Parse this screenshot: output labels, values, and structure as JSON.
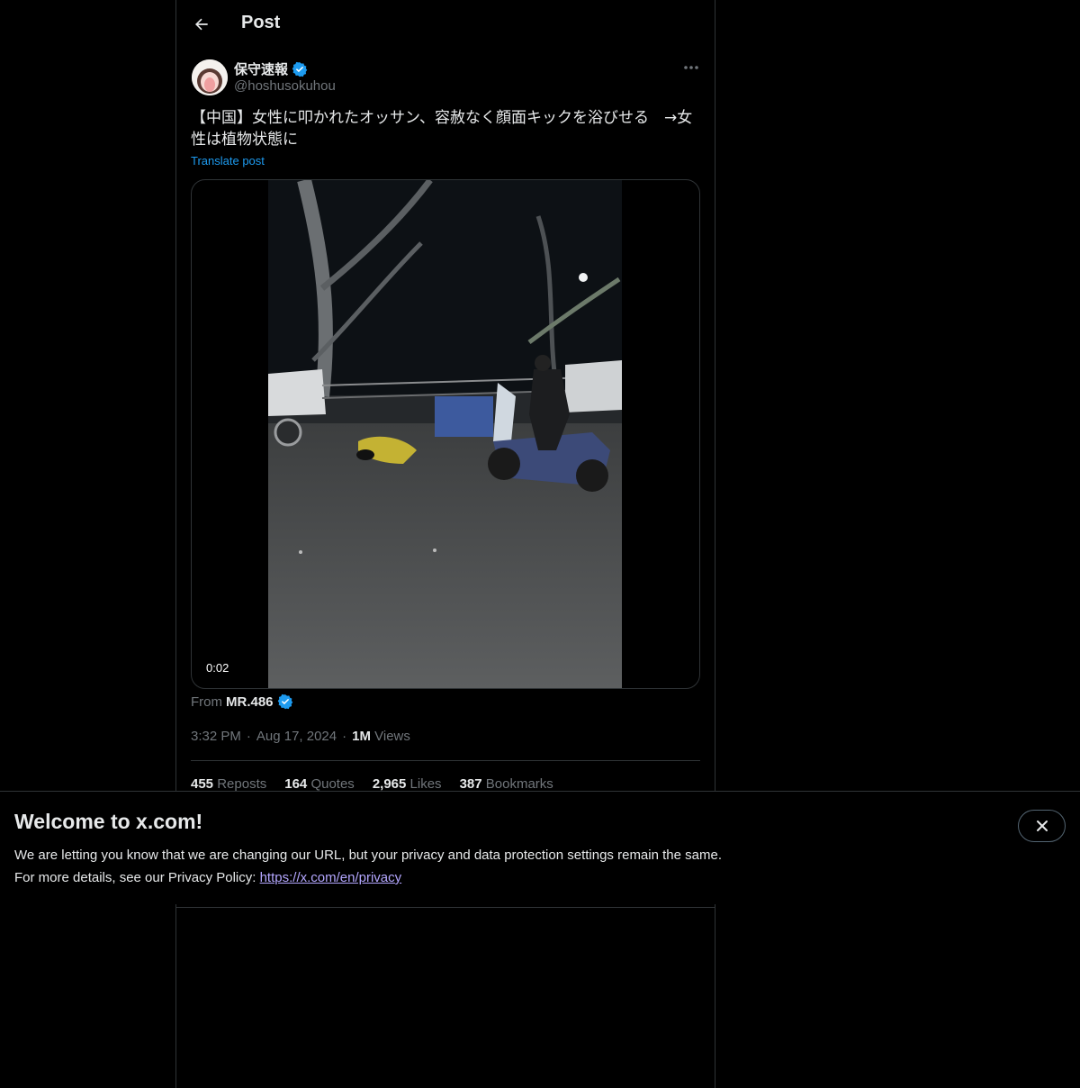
{
  "header": {
    "title": "Post",
    "back_icon": "arrow-left-icon"
  },
  "post": {
    "author": {
      "display_name": "保守速報",
      "handle": "@hoshusokuhou",
      "verified": true,
      "verified_color": "#1d9bf0"
    },
    "more_icon": "more-horizontal-icon",
    "text_line1": "【中国】女性に叩かれたオッサン、容赦なく顔面キックを浴びせる　→女",
    "text_line2": "性は植物状態に",
    "translate_label": "Translate post",
    "video": {
      "duration": "0:02"
    },
    "from_label": "From",
    "from_name": "MR.486",
    "time": "3:32 PM",
    "sep": "·",
    "date": "Aug 17, 2024",
    "views_count": "1M",
    "views_label": "Views",
    "stats": [
      {
        "count": "455",
        "label": "Reposts"
      },
      {
        "count": "164",
        "label": "Quotes"
      },
      {
        "count": "2,965",
        "label": "Likes"
      },
      {
        "count": "387",
        "label": "Bookmarks"
      }
    ]
  },
  "banner": {
    "title": "Welcome to x.com!",
    "line1": "We are letting you know that we are changing our URL, but your privacy and data protection settings remain the same.",
    "line2_prefix": "For more details, see our Privacy Policy: ",
    "link_text": "https://x.com/en/privacy",
    "close_icon": "close-icon"
  },
  "colors": {
    "accent": "#1d9bf0",
    "link": "#b4a7ff",
    "muted": "#71767b"
  }
}
